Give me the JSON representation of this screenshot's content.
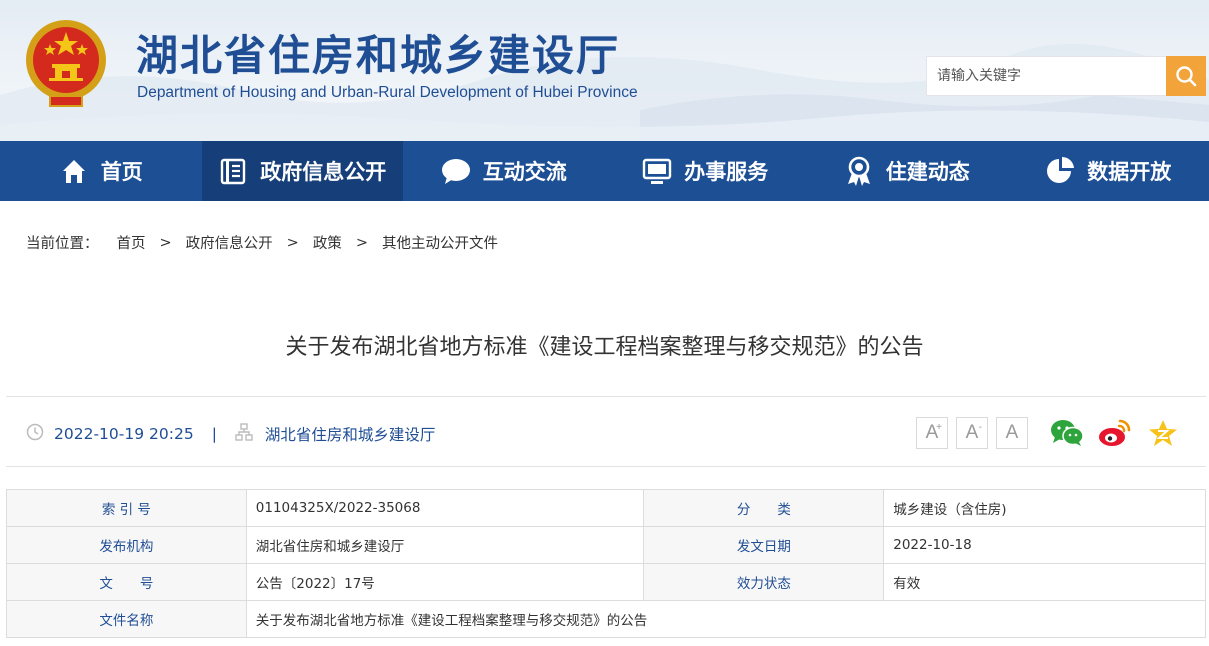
{
  "header": {
    "title": "湖北省住房和城乡建设厅",
    "subtitle": "Department of Housing and Urban-Rural Development of Hubei Province",
    "emblem_icon": "national-emblem-icon",
    "search": {
      "placeholder": "请输入关键字",
      "value": "",
      "button_icon": "search-icon"
    },
    "colors": {
      "title": "#1f4e95",
      "search_button": "#f2a33a"
    }
  },
  "nav": {
    "items": [
      {
        "label": "首页",
        "icon": "home-icon"
      },
      {
        "label": "政府信息公开",
        "icon": "document-list-icon",
        "active": true
      },
      {
        "label": "互动交流",
        "icon": "chat-bubble-icon"
      },
      {
        "label": "办事服务",
        "icon": "monitor-icon"
      },
      {
        "label": "住建动态",
        "icon": "award-ribbon-icon"
      },
      {
        "label": "数据开放",
        "icon": "pie-chart-icon"
      }
    ],
    "colors": {
      "background": "#1d4f95",
      "active": "#163f79"
    }
  },
  "breadcrumb": {
    "prefix": "当前位置：",
    "separator": ">",
    "items": [
      "首页",
      "政府信息公开",
      "政策",
      "其他主动公开文件"
    ]
  },
  "article": {
    "title": "关于发布湖北省地方标准《建设工程档案整理与移交规范》的公告",
    "datetime": "2022-10-19 20:25",
    "divider": "|",
    "source": "湖北省住房和城乡建设厅",
    "font_buttons": [
      {
        "label": "A",
        "modifier": "+",
        "icon": "font-increase-icon"
      },
      {
        "label": "A",
        "modifier": "-",
        "icon": "font-decrease-icon"
      },
      {
        "label": "A",
        "modifier": "",
        "icon": "font-reset-icon"
      }
    ],
    "share_icons": [
      "wechat-icon",
      "weibo-icon",
      "favorite-star-icon"
    ]
  },
  "info_table": {
    "rows": [
      [
        {
          "label": "索 引 号",
          "value": "01104325X/2022-35068"
        },
        {
          "label": "分　　类",
          "value": "城乡建设（含住房)"
        }
      ],
      [
        {
          "label": "发布机构",
          "value": "湖北省住房和城乡建设厅"
        },
        {
          "label": "发文日期",
          "value": "2022-10-18"
        }
      ],
      [
        {
          "label": "文　　号",
          "value": "公告〔2022〕17号"
        },
        {
          "label": "效力状态",
          "value": "有效"
        }
      ]
    ],
    "full_row": {
      "label": "文件名称",
      "value": "关于发布湖北省地方标准《建设工程档案整理与移交规范》的公告"
    }
  }
}
